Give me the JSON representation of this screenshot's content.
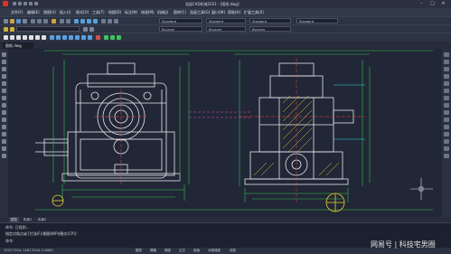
{
  "window": {
    "title": "浩辰CAD机械2021 - [图纸.dwg]",
    "controls": [
      "–",
      "□",
      "✕"
    ]
  },
  "menubar": {
    "items": [
      "文件(F)",
      "编辑(E)",
      "视图(V)",
      "插入(I)",
      "格式(O)",
      "工具(T)",
      "绘图(D)",
      "标注(N)",
      "修改(M)",
      "机械(J)",
      "图库(C)",
      "浩辰工具(G)",
      "窗口(W)",
      "帮助(H)",
      "扩展工具(X)"
    ]
  },
  "toolbar": {
    "combos": [
      "Standard",
      "Standard",
      "Standard",
      "Standard",
      "ByLayer",
      "ByLayer",
      "ByLayer"
    ]
  },
  "document": {
    "tab_label": "图纸.dwg"
  },
  "layout_tabs": [
    "模型",
    "布局1",
    "布局2"
  ],
  "command": {
    "lines": [
      "命令: 已找到...",
      "指定对角点或 [栏选(F)/圈围(WP)/圈交(CP)]:",
      "命令:"
    ]
  },
  "status": {
    "coords": "1523.7104, 1167.3254, 0.0000",
    "items": [
      "模型",
      "栅格",
      "捕捉",
      "正交",
      "极轴",
      "对象捕捉",
      "线宽"
    ]
  },
  "watermark": "网易号 | 科技宅男圈",
  "colors": {
    "canvas_bg": "#212736",
    "line_white": "#e6e8ee",
    "line_green": "#36c24a",
    "line_cyan": "#3fd6e0",
    "line_red": "#ff3b3b",
    "line_yellow": "#f0d030",
    "line_magenta": "#e14bd6"
  },
  "icons": {
    "app": "app-logo-icon",
    "snap": "crosshair-icon"
  }
}
